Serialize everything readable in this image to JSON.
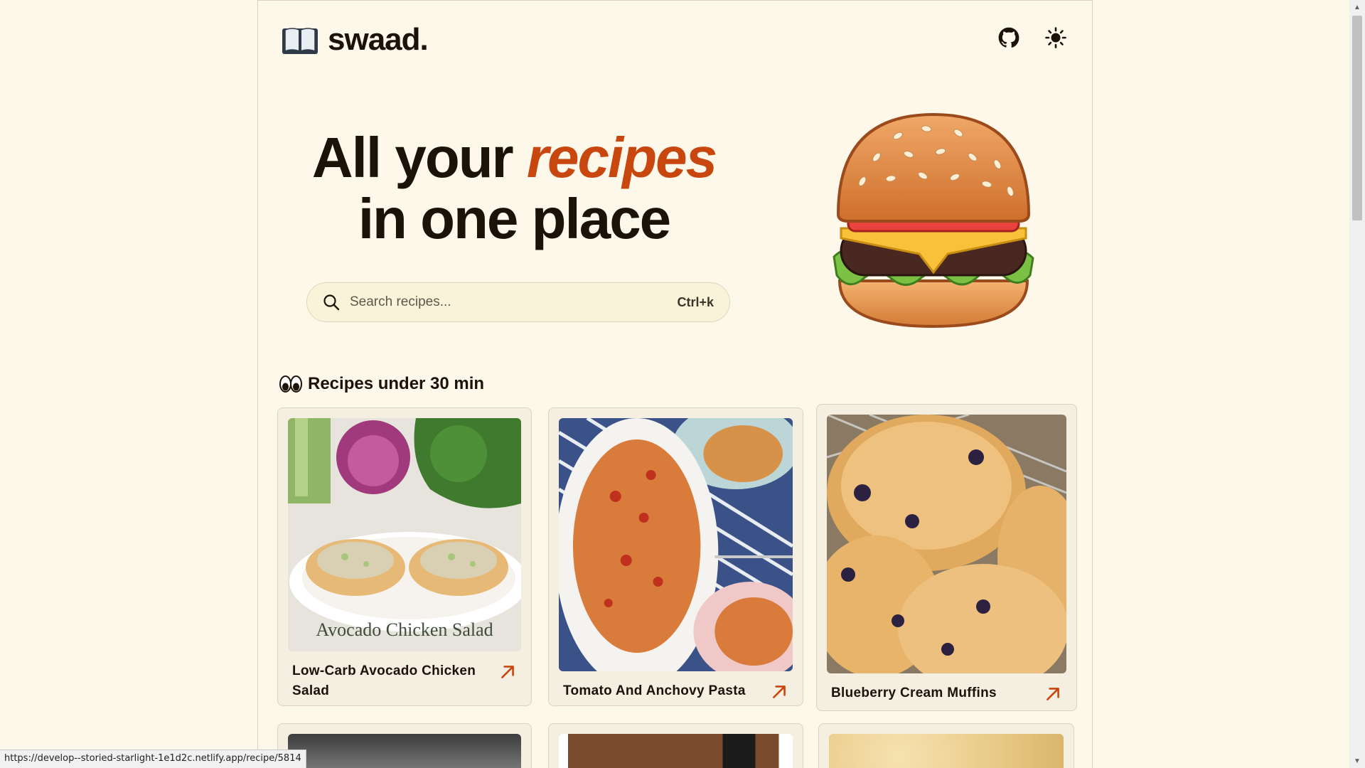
{
  "header": {
    "logo_text": "swaad.",
    "github_icon": "github-icon",
    "theme_icon": "sun-icon"
  },
  "hero": {
    "title_part1": "All your ",
    "title_accent": "recipes",
    "title_part2": "in one place",
    "accent_color": "#c8470f",
    "illustration": "hamburger-emoji"
  },
  "search": {
    "placeholder": "Search recipes...",
    "shortcut": "Ctrl+k"
  },
  "section": {
    "icon": "eyes-emoji",
    "title": "Recipes under 30 min"
  },
  "recipes": [
    {
      "name": "Low-Carb Avocado Chicken Salad",
      "image_caption": "Avocado Chicken Salad"
    },
    {
      "name": "Tomato And Anchovy Pasta"
    },
    {
      "name": "Blueberry Cream Muffins"
    },
    {
      "name": ""
    },
    {
      "name": ""
    },
    {
      "name": ""
    }
  ],
  "status_bar": {
    "url": "https://develop--storied-starlight-1e1d2c.netlify.app/recipe/5814"
  },
  "colors": {
    "background": "#fdf8ea",
    "card": "#f5efe2",
    "accent": "#c8470f"
  }
}
